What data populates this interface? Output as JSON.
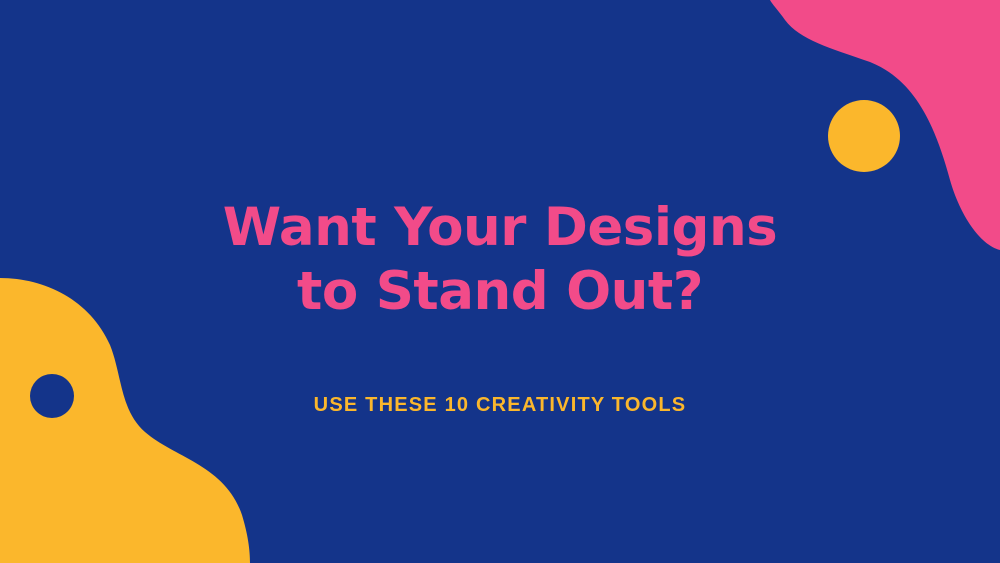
{
  "colors": {
    "background": "#14348a",
    "pink": "#f24b89",
    "yellow": "#fbb72c"
  },
  "headline": {
    "line1": "Want Your Designs",
    "line2": "to Stand Out?"
  },
  "subheadline": "USE THESE 10 CREATIVITY TOOLS"
}
